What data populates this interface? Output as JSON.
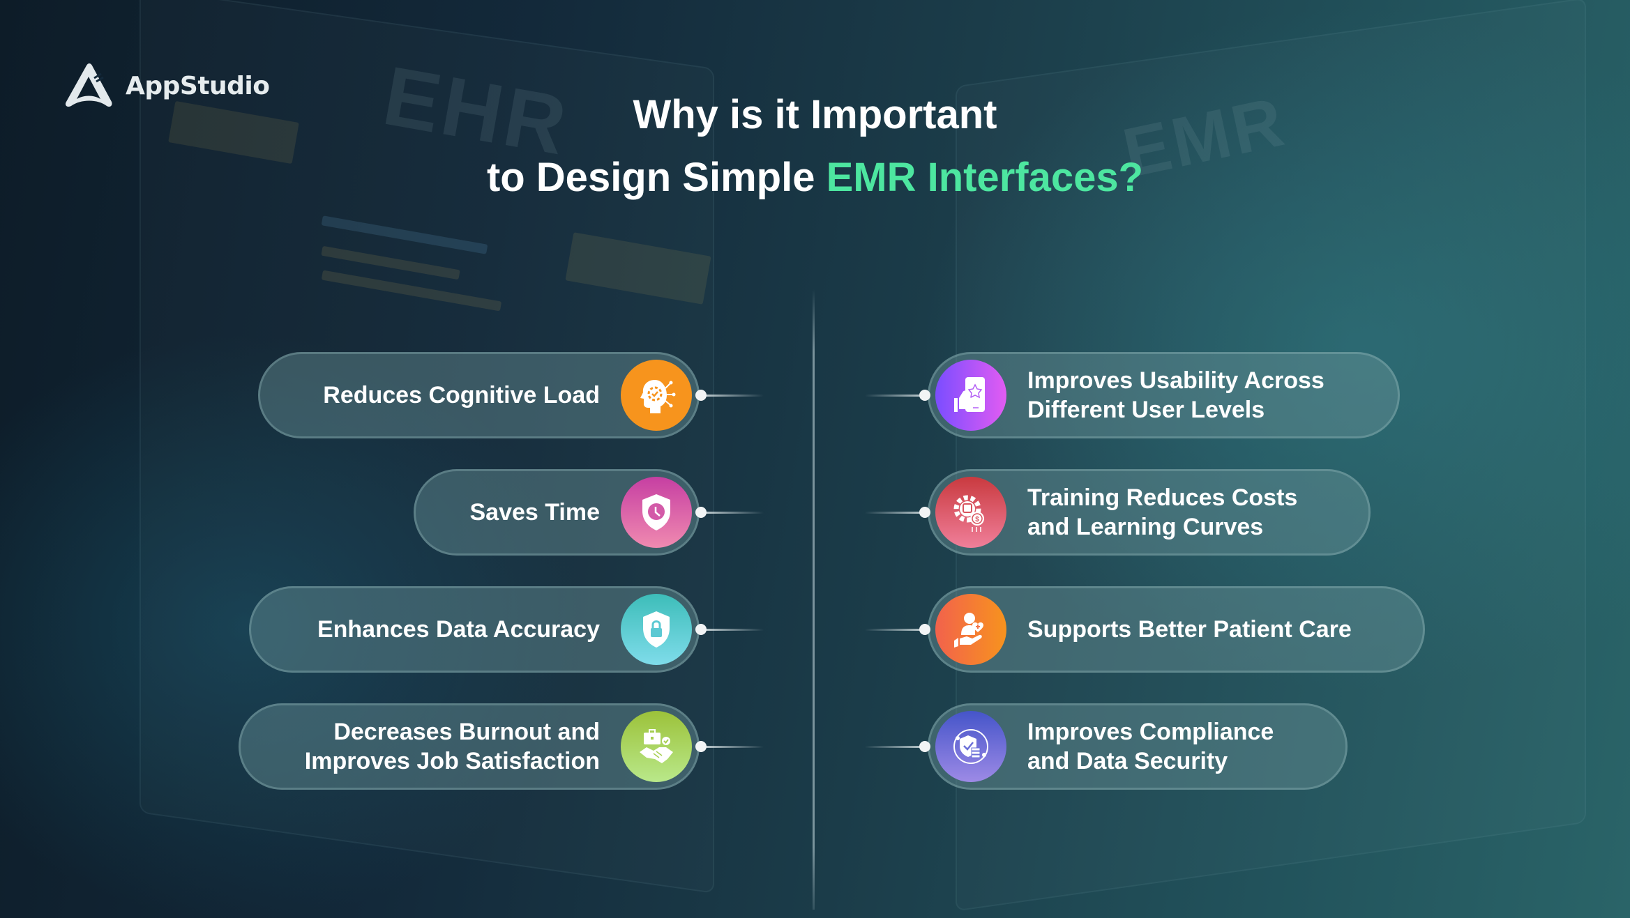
{
  "brand": {
    "name": "AppStudio",
    "logo_icon": "appstudio-triangle-logo-icon"
  },
  "title": {
    "line1": "Why is it Important",
    "line2_prefix": "to Design Simple ",
    "line2_accent": "EMR Interfaces?"
  },
  "background_words": [
    "EHR",
    "EMR"
  ],
  "colors": {
    "accent": "#4de6a0",
    "text": "#ffffff"
  },
  "left_items": [
    {
      "lines": [
        "Reduces Cognitive Load"
      ],
      "icon": "brain-gear-icon",
      "gradient": [
        "#f7941d",
        "#f7941d"
      ]
    },
    {
      "lines": [
        "Saves Time"
      ],
      "icon": "shield-clock-icon",
      "gradient": [
        "#c63fa2",
        "#f08ab0"
      ]
    },
    {
      "lines": [
        "Enhances Data Accuracy"
      ],
      "icon": "shield-lock-icon",
      "gradient": [
        "#3dbdb9",
        "#7fdcea"
      ]
    },
    {
      "lines": [
        "Decreases Burnout and",
        "Improves Job Satisfaction"
      ],
      "icon": "briefcase-handshake-icon",
      "gradient": [
        "#9cc23a",
        "#b9e88a"
      ]
    }
  ],
  "right_items": [
    {
      "lines": [
        "Improves Usability Across",
        "Different User Levels"
      ],
      "icon": "phone-thumbs-up-icon",
      "gradient": [
        "#7a4dff",
        "#e25cf2"
      ]
    },
    {
      "lines": [
        "Training Reduces Costs",
        "and Learning Curves"
      ],
      "icon": "gear-money-icon",
      "gradient": [
        "#c93a3f",
        "#f07f9a"
      ]
    },
    {
      "lines": [
        "Supports Better Patient Care"
      ],
      "icon": "patient-care-hand-icon",
      "gradient": [
        "#f2624c",
        "#f7931e"
      ]
    },
    {
      "lines": [
        "Improves Compliance",
        "and Data Security"
      ],
      "icon": "shield-check-server-icon",
      "gradient": [
        "#4555c9",
        "#9d8ae6"
      ]
    }
  ]
}
